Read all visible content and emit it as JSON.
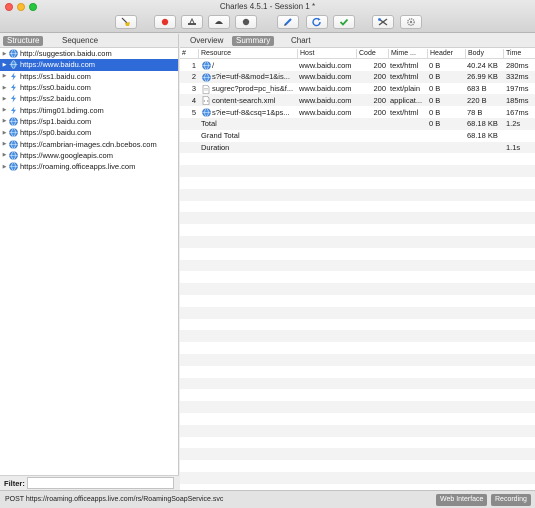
{
  "window": {
    "title": "Charles 4.5.1 - Session 1 *"
  },
  "toolbar": {
    "buttons": [
      {
        "icon": "broom-icon"
      },
      {
        "icon": "record-icon"
      },
      {
        "icon": "throttle-icon"
      },
      {
        "icon": "turtle-icon"
      },
      {
        "icon": "breakpoint-icon"
      },
      {
        "icon": "pen-icon"
      },
      {
        "icon": "refresh-icon"
      },
      {
        "icon": "checkmark-icon"
      },
      {
        "icon": "tools-icon"
      },
      {
        "icon": "settings-gear-icon"
      }
    ]
  },
  "left": {
    "tabs": [
      "Structure",
      "Sequence"
    ],
    "hosts": [
      {
        "label": "http://suggestion.baidu.com",
        "icon": "globe"
      },
      {
        "label": "https://www.baidu.com",
        "icon": "globe",
        "selected": true
      },
      {
        "label": "https://ss1.baidu.com",
        "icon": "bolt"
      },
      {
        "label": "https://ss0.baidu.com",
        "icon": "bolt"
      },
      {
        "label": "https://ss2.baidu.com",
        "icon": "bolt"
      },
      {
        "label": "https://timg01.bdimg.com",
        "icon": "bolt"
      },
      {
        "label": "https://sp1.baidu.com",
        "icon": "globe"
      },
      {
        "label": "https://sp0.baidu.com",
        "icon": "globe"
      },
      {
        "label": "https://cambrian-images.cdn.bcebos.com",
        "icon": "globe"
      },
      {
        "label": "https://www.googleapis.com",
        "icon": "globe"
      },
      {
        "label": "https://roaming.officeapps.live.com",
        "icon": "globe"
      }
    ],
    "filter_label": "Filter:",
    "filter_value": ""
  },
  "right": {
    "tabs": [
      "Overview",
      "Summary",
      "Chart"
    ],
    "active_tab": "Summary",
    "columns": [
      "#",
      "Resource",
      "Host",
      "Code",
      "Mime ...",
      "Header",
      "Body",
      "Time"
    ],
    "rows": [
      {
        "num": "1",
        "icon": "globe",
        "resource": "/",
        "host": "www.baidu.com",
        "code": "200",
        "mime": "text/html",
        "header": "0 B",
        "body": "40.24 KB",
        "time": "280ms"
      },
      {
        "num": "2",
        "icon": "globe",
        "resource": "s?ie=utf-8&mod=1&is...",
        "host": "www.baidu.com",
        "code": "200",
        "mime": "text/html",
        "header": "0 B",
        "body": "26.99 KB",
        "time": "332ms"
      },
      {
        "num": "3",
        "icon": "doc",
        "resource": "sugrec?prod=pc_his&f...",
        "host": "www.baidu.com",
        "code": "200",
        "mime": "text/plain",
        "header": "0 B",
        "body": "683 B",
        "time": "197ms"
      },
      {
        "num": "4",
        "icon": "xml",
        "resource": "content-search.xml",
        "host": "www.baidu.com",
        "code": "200",
        "mime": "applicat...",
        "header": "0 B",
        "body": "220 B",
        "time": "185ms"
      },
      {
        "num": "5",
        "icon": "globe",
        "resource": "s?ie=utf-8&csq=1&ps...",
        "host": "www.baidu.com",
        "code": "200",
        "mime": "text/html",
        "header": "0 B",
        "body": "78 B",
        "time": "167ms"
      }
    ],
    "totals": [
      {
        "label": "Total",
        "header": "0 B",
        "body": "68.18 KB",
        "time": "1.2s"
      },
      {
        "label": "Grand Total",
        "header": "",
        "body": "68.18 KB",
        "time": ""
      },
      {
        "label": "Duration",
        "header": "",
        "body": "",
        "time": "1.1s"
      }
    ]
  },
  "status": {
    "text": "POST https://roaming.officeapps.live.com/rs/RoamingSoapService.svc",
    "web_interface": "Web Interface",
    "recording": "Recording"
  }
}
